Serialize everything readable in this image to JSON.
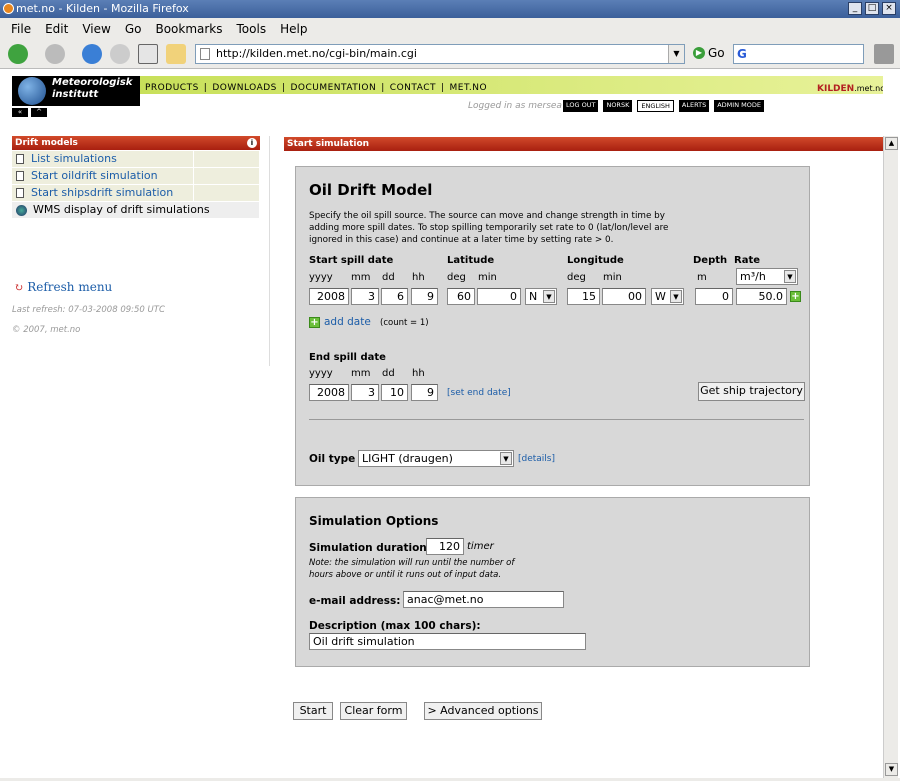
{
  "window": {
    "title": "met.no - Kilden - Mozilla Firefox"
  },
  "menubar": {
    "items": [
      "File",
      "Edit",
      "View",
      "Go",
      "Bookmarks",
      "Tools",
      "Help"
    ]
  },
  "toolbar": {
    "url": "http://kilden.met.no/cgi-bin/main.cgi",
    "go_label": "Go"
  },
  "header": {
    "logo_line1": "Meteorologisk",
    "logo_line2": "institutt",
    "nav": [
      "PRODUCTS",
      "DOWNLOADS",
      "DOCUMENTATION",
      "CONTACT",
      "MET.NO"
    ],
    "site_name": "KILDEN",
    "site_domain": ".met.no",
    "logged_in": "Logged in as mersea",
    "buttons": [
      "LOG OUT",
      "NORSK",
      "ENGLISH",
      "ALERTS",
      "ADMIN MODE"
    ]
  },
  "sidebar": {
    "title": "Drift models",
    "items": [
      "List simulations",
      "Start oildrift simulation",
      "Start shipsdrift simulation",
      "WMS display of drift simulations"
    ],
    "refresh": "Refresh menu",
    "last_refresh": "Last refresh: 07-03-2008 09:50 UTC",
    "copyright": "© 2007, met.no"
  },
  "main": {
    "header": "Start simulation",
    "model_title": "Oil Drift Model",
    "intro": "Specify the oil spill source. The source can move and change strength in time by adding more spill dates. To stop spilling temporarily set rate to 0 (lat/lon/level are ignored in this case) and continue at a later time by setting rate > 0.",
    "start_label": "Start spill date",
    "latitude_label": "Latitude",
    "longitude_label": "Longitude",
    "depth_label": "Depth",
    "rate_label": "Rate",
    "units": {
      "yyyy": "yyyy",
      "mm": "mm",
      "dd": "dd",
      "hh": "hh",
      "deg": "deg",
      "min": "min",
      "m": "m"
    },
    "rate_unit": "m³/h",
    "start": {
      "yyyy": "2008",
      "mm": "3",
      "dd": "6",
      "hh": "9"
    },
    "lat": {
      "deg": "60",
      "min": "0",
      "dir": "N"
    },
    "lon": {
      "deg": "15",
      "min": "00",
      "dir": "W"
    },
    "depth": "0",
    "rate": "50.0",
    "add_date": "add date",
    "count": "(count = 1)",
    "end_label": "End spill date",
    "end": {
      "yyyy": "2008",
      "mm": "3",
      "dd": "10",
      "hh": "9"
    },
    "set_end": "[set end date]",
    "ship_button": "Get ship trajectory",
    "oil_type_label": "Oil type",
    "oil_type": "LIGHT (draugen)",
    "details": "[details]"
  },
  "options": {
    "title": "Simulation Options",
    "duration_label": "Simulation duration",
    "duration": "120",
    "duration_unit": "timer",
    "note_line1": "Note: the simulation will run until the number of",
    "note_line2": "hours above or until it runs out of input data.",
    "email_label": "e-mail address:",
    "email": "anac@met.no",
    "desc_label": "Description (max 100 chars):",
    "desc": "Oil drift simulation"
  },
  "actions": {
    "start": "Start",
    "clear": "Clear form",
    "advanced": "> Advanced options"
  },
  "colors": {
    "accent": "#b32020",
    "nav_bar": "#c8e05a",
    "panel": "#d8d8d8",
    "link": "#1c5da8"
  }
}
